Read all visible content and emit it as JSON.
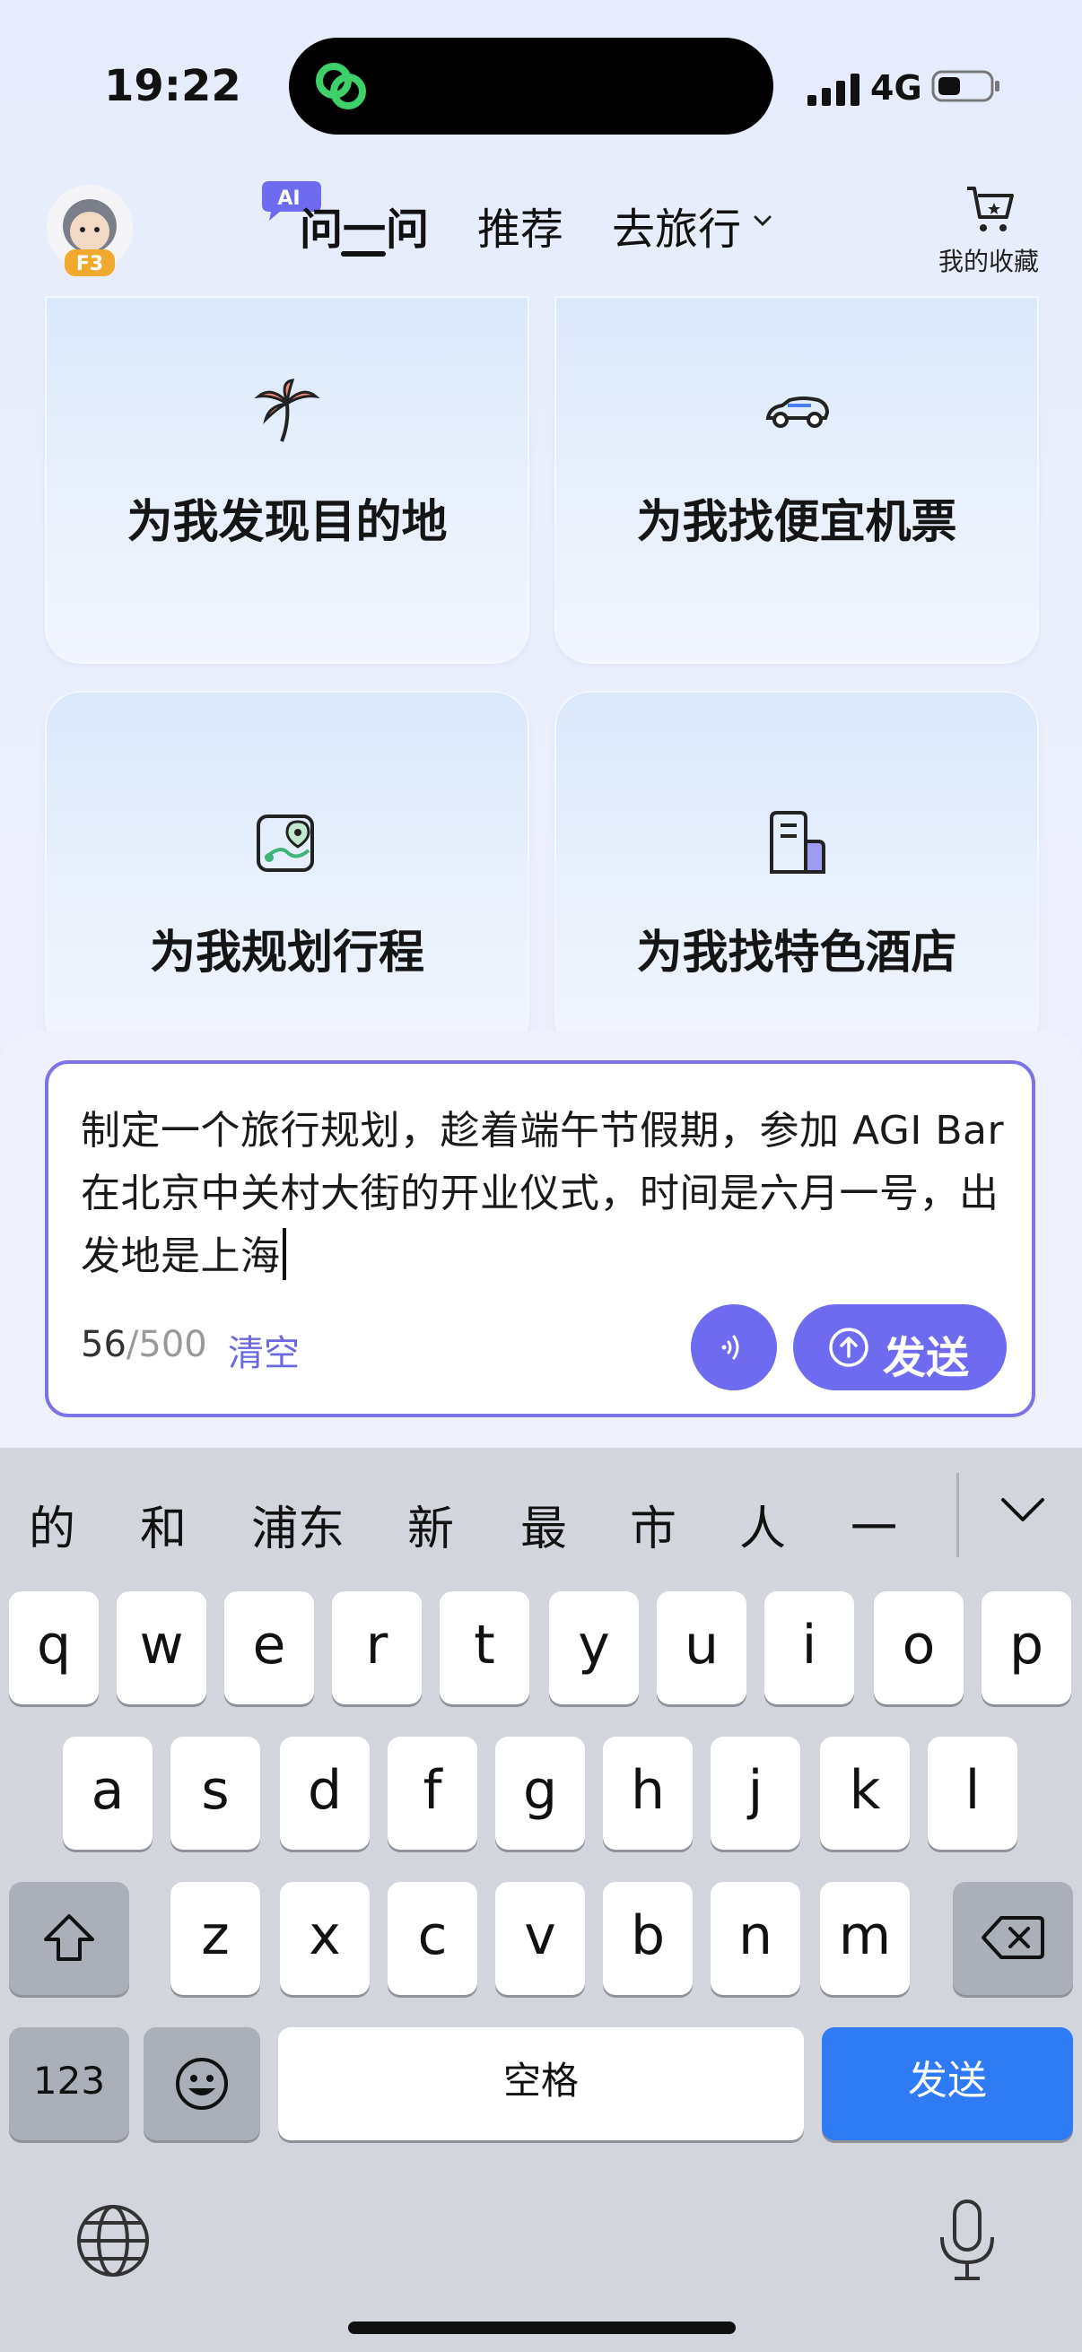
{
  "status_bar": {
    "time": "19:22",
    "network": "4G"
  },
  "header": {
    "ai_badge": "AI",
    "tabs": [
      {
        "label": "问一问"
      },
      {
        "label": "推荐"
      },
      {
        "label": "去旅行"
      }
    ],
    "favorites_label": "我的收藏"
  },
  "cards": [
    {
      "label": "为我发现目的地",
      "icon": "palm-tree-icon"
    },
    {
      "label": "为我找便宜机票",
      "icon": "car-icon"
    },
    {
      "label": "为我规划行程",
      "icon": "map-icon"
    },
    {
      "label": "为我找特色酒店",
      "icon": "hotel-icon"
    }
  ],
  "input": {
    "text": "制定一个旅行规划，趁着端午节假期，参加 AGI Bar 在北京中关村大街的开业仪式，时间是六月一号，出发地是上海",
    "count_used": "56",
    "count_max": "/500",
    "clear_label": "清空",
    "send_label": "发送"
  },
  "keyboard": {
    "suggestions": [
      "的",
      "和",
      "浦东",
      "新",
      "最",
      "市",
      "人",
      "一"
    ],
    "row1": [
      "q",
      "w",
      "e",
      "r",
      "t",
      "y",
      "u",
      "i",
      "o",
      "p"
    ],
    "row2": [
      "a",
      "s",
      "d",
      "f",
      "g",
      "h",
      "j",
      "k",
      "l"
    ],
    "row3": [
      "z",
      "x",
      "c",
      "v",
      "b",
      "n",
      "m"
    ],
    "numbers_label": "123",
    "space_label": "空格",
    "return_label": "发送"
  },
  "colors": {
    "accent": "#6f6bf0",
    "keyboard_return": "#2f7bf5",
    "keyboard_bg": "#d2d5dc"
  }
}
